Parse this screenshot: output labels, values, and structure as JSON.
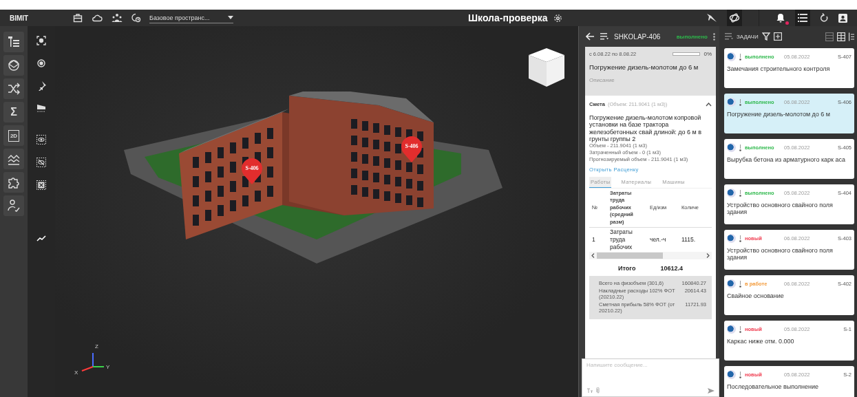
{
  "topbar": {
    "logo": "BIMIT",
    "space_select": "Базовое пространс...",
    "title": "Школа-проверка",
    "notification_dot": true
  },
  "left_toolbar": [
    {
      "kind": "tree"
    },
    {
      "kind": "layers"
    },
    {
      "kind": "shuffle"
    },
    {
      "kind": "text",
      "label": "Σ"
    },
    {
      "kind": "boxed",
      "label": "2D"
    },
    {
      "kind": "chart"
    },
    {
      "kind": "puzzle"
    },
    {
      "kind": "route"
    }
  ],
  "view_toolbar": [
    {
      "kind": "focus"
    },
    {
      "kind": "target"
    },
    {
      "kind": "pin"
    },
    {
      "kind": "section"
    },
    {
      "kind": "eye"
    },
    {
      "kind": "eye-off"
    },
    {
      "kind": "cross"
    }
  ],
  "viewport": {
    "pins": [
      {
        "label": "S-406"
      },
      {
        "label": "S-406"
      }
    ],
    "axes": [
      {
        "label": "Z"
      },
      {
        "label": "X"
      },
      {
        "label": "Y"
      }
    ]
  },
  "detail": {
    "code": "SHKOLAP-406",
    "status": "выполнено",
    "color": "#2db84b",
    "dates": "с 6.08.22 по 8.08.22",
    "level": 0,
    "percent": "0%",
    "title": "Погружение дизель-молотом до 6 м",
    "description_label": "Описание",
    "estimate": {
      "label": "Смета",
      "volume": "(Объем: 211.9041 (1 м3))",
      "expanded": true,
      "name": "Погружение дизель-молотом копровой установки на базе трактора железобетонных свай длиной: до 6 м в грунты группы 2",
      "lines": [
        "Объем - 211.9041 (1 м3)",
        "Затраченный объем - 0 (1 м3)",
        "Прогнозируемый объем - 211.9041 (1 м3)"
      ],
      "link": "Открыть Расценку",
      "tabs": [
        {
          "label": "Работы",
          "selected": true
        },
        {
          "label": "Материалы",
          "selected": false
        },
        {
          "label": "Машины",
          "selected": false
        }
      ],
      "columns": [
        "№",
        "Затраты труда рабочих (средний разм)",
        "Ед/изм",
        "Количе"
      ],
      "rows": [
        [
          "1",
          "Затраты труда рабочих",
          "чел.-ч",
          "1115."
        ]
      ],
      "total_label": "Итого",
      "total": "10612.4",
      "summary": [
        {
          "label": "Всего на физобъем (301,6)",
          "value": "160840.27"
        },
        {
          "label": "Накладные расходы 102% ФОТ (20210.22)",
          "value": "20614.43"
        },
        {
          "label": "Сметная прибыль 58% ФОТ (от 20210.22)",
          "value": "11721.93"
        }
      ]
    },
    "message_placeholder": "Напишите сообщение..."
  },
  "tasks": {
    "title": "ЗАДАЧИ",
    "items": [
      {
        "status": "выполнено",
        "color": "#2db84b",
        "date": "05.08.2022",
        "code": "S-407",
        "title": "Замечания строительного контроля",
        "selected": false
      },
      {
        "status": "выполнено",
        "color": "#2db84b",
        "date": "06.08.2022",
        "code": "S-406",
        "title": "Погружение дизель-молотом до 6 м",
        "selected": true
      },
      {
        "status": "выполнено",
        "color": "#2db84b",
        "date": "05.08.2022",
        "code": "S-405",
        "title": "Вырубка бетона из арматурного карк аса",
        "selected": false
      },
      {
        "status": "выполнено",
        "color": "#2db84b",
        "date": "05.08.2022",
        "code": "S-404",
        "title": "Устройство основного свайного поля здания",
        "selected": false
      },
      {
        "status": "новый",
        "color": "#f0394d",
        "date": "06.08.2022",
        "code": "S-403",
        "title": "Устройство основного свайного поля здания",
        "selected": false
      },
      {
        "status": "в работе",
        "color": "#f39a3a",
        "date": "06.08.2022",
        "code": "S-402",
        "title": "Свайное основание",
        "selected": false
      },
      {
        "status": "новый",
        "color": "#f0394d",
        "date": "05.08.2022",
        "code": "S-1",
        "title": "Каркас ниже отм. 0.000",
        "selected": false
      },
      {
        "status": "новый",
        "color": "#f0394d",
        "date": "05.08.2022",
        "code": "S-2",
        "title": "Последовательное выполнение",
        "selected": false
      }
    ]
  }
}
